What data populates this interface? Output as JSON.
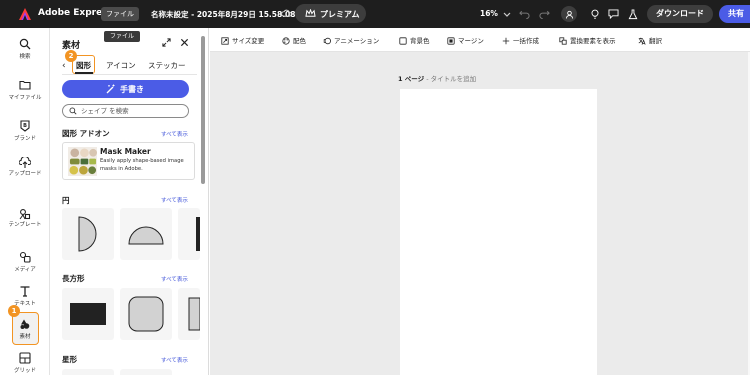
{
  "topbar": {
    "app_name": "Adobe Express",
    "file_label": "ファイル",
    "doc_title": "名称未設定 - 2025年8月29日 15.58.08",
    "premium_label": "プレミアム",
    "zoom": "16%",
    "download_label": "ダウンロード",
    "share_label": "共有"
  },
  "tooltip": {
    "text": "ファイル"
  },
  "rail": {
    "items": [
      {
        "label": "検索",
        "icon": "search-icon"
      },
      {
        "label": "マイファイル",
        "icon": "folder-icon"
      },
      {
        "label": "ブランド",
        "icon": "brand-icon"
      },
      {
        "label": "アップロード",
        "icon": "upload-icon"
      },
      {
        "label": "テンプレート",
        "icon": "template-icon"
      },
      {
        "label": "メディア",
        "icon": "media-icon"
      },
      {
        "label": "テキスト",
        "icon": "text-icon"
      },
      {
        "label": "素材",
        "icon": "elements-icon"
      },
      {
        "label": "グリッド",
        "icon": "grid-icon"
      }
    ]
  },
  "badges": {
    "rail_step": "1",
    "tab_step": "2"
  },
  "panel": {
    "title": "素材",
    "tabs": [
      "図形",
      "アイコン",
      "ステッカー"
    ],
    "active_tab": "図形",
    "generate_label": "手書き",
    "search_placeholder": "シェイプ を検索",
    "see_all": "すべて表示",
    "sections": {
      "addons": "図形 アドオン",
      "circle": "円",
      "rectangle": "長方形",
      "star": "星形"
    },
    "addon": {
      "name": "Mask Maker",
      "description": "Easily apply shape-based image masks in Adobe."
    }
  },
  "context_toolbar": {
    "items": [
      {
        "label": "サイズ変更",
        "icon": "resize-icon"
      },
      {
        "label": "配色",
        "icon": "palette-icon"
      },
      {
        "label": "アニメーション",
        "icon": "animation-icon"
      },
      {
        "label": "背景色",
        "icon": "background-color-icon"
      },
      {
        "label": "マージン",
        "icon": "margin-icon"
      },
      {
        "label": "一括作成",
        "icon": "bulk-create-icon"
      },
      {
        "label": "置換要素を表示",
        "icon": "replace-icon"
      },
      {
        "label": "翻訳",
        "icon": "translate-icon"
      }
    ]
  },
  "canvas": {
    "page_number": "1 ページ",
    "title_placeholder": "タイトルを追加"
  },
  "colors": {
    "accent": "#4b5ce6",
    "highlight": "#f29423",
    "topbar": "#1e1e1e",
    "canvas_bg": "#ebebeb"
  }
}
